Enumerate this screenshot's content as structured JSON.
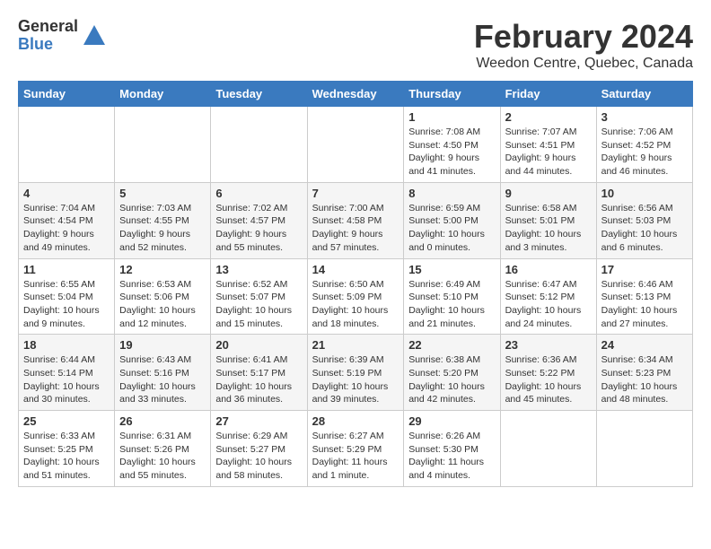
{
  "logo": {
    "general": "General",
    "blue": "Blue"
  },
  "title": {
    "month": "February 2024",
    "location": "Weedon Centre, Quebec, Canada"
  },
  "weekdays": [
    "Sunday",
    "Monday",
    "Tuesday",
    "Wednesday",
    "Thursday",
    "Friday",
    "Saturday"
  ],
  "weeks": [
    [
      {
        "day": "",
        "info": ""
      },
      {
        "day": "",
        "info": ""
      },
      {
        "day": "",
        "info": ""
      },
      {
        "day": "",
        "info": ""
      },
      {
        "day": "1",
        "info": "Sunrise: 7:08 AM\nSunset: 4:50 PM\nDaylight: 9 hours and 41 minutes."
      },
      {
        "day": "2",
        "info": "Sunrise: 7:07 AM\nSunset: 4:51 PM\nDaylight: 9 hours and 44 minutes."
      },
      {
        "day": "3",
        "info": "Sunrise: 7:06 AM\nSunset: 4:52 PM\nDaylight: 9 hours and 46 minutes."
      }
    ],
    [
      {
        "day": "4",
        "info": "Sunrise: 7:04 AM\nSunset: 4:54 PM\nDaylight: 9 hours and 49 minutes."
      },
      {
        "day": "5",
        "info": "Sunrise: 7:03 AM\nSunset: 4:55 PM\nDaylight: 9 hours and 52 minutes."
      },
      {
        "day": "6",
        "info": "Sunrise: 7:02 AM\nSunset: 4:57 PM\nDaylight: 9 hours and 55 minutes."
      },
      {
        "day": "7",
        "info": "Sunrise: 7:00 AM\nSunset: 4:58 PM\nDaylight: 9 hours and 57 minutes."
      },
      {
        "day": "8",
        "info": "Sunrise: 6:59 AM\nSunset: 5:00 PM\nDaylight: 10 hours and 0 minutes."
      },
      {
        "day": "9",
        "info": "Sunrise: 6:58 AM\nSunset: 5:01 PM\nDaylight: 10 hours and 3 minutes."
      },
      {
        "day": "10",
        "info": "Sunrise: 6:56 AM\nSunset: 5:03 PM\nDaylight: 10 hours and 6 minutes."
      }
    ],
    [
      {
        "day": "11",
        "info": "Sunrise: 6:55 AM\nSunset: 5:04 PM\nDaylight: 10 hours and 9 minutes."
      },
      {
        "day": "12",
        "info": "Sunrise: 6:53 AM\nSunset: 5:06 PM\nDaylight: 10 hours and 12 minutes."
      },
      {
        "day": "13",
        "info": "Sunrise: 6:52 AM\nSunset: 5:07 PM\nDaylight: 10 hours and 15 minutes."
      },
      {
        "day": "14",
        "info": "Sunrise: 6:50 AM\nSunset: 5:09 PM\nDaylight: 10 hours and 18 minutes."
      },
      {
        "day": "15",
        "info": "Sunrise: 6:49 AM\nSunset: 5:10 PM\nDaylight: 10 hours and 21 minutes."
      },
      {
        "day": "16",
        "info": "Sunrise: 6:47 AM\nSunset: 5:12 PM\nDaylight: 10 hours and 24 minutes."
      },
      {
        "day": "17",
        "info": "Sunrise: 6:46 AM\nSunset: 5:13 PM\nDaylight: 10 hours and 27 minutes."
      }
    ],
    [
      {
        "day": "18",
        "info": "Sunrise: 6:44 AM\nSunset: 5:14 PM\nDaylight: 10 hours and 30 minutes."
      },
      {
        "day": "19",
        "info": "Sunrise: 6:43 AM\nSunset: 5:16 PM\nDaylight: 10 hours and 33 minutes."
      },
      {
        "day": "20",
        "info": "Sunrise: 6:41 AM\nSunset: 5:17 PM\nDaylight: 10 hours and 36 minutes."
      },
      {
        "day": "21",
        "info": "Sunrise: 6:39 AM\nSunset: 5:19 PM\nDaylight: 10 hours and 39 minutes."
      },
      {
        "day": "22",
        "info": "Sunrise: 6:38 AM\nSunset: 5:20 PM\nDaylight: 10 hours and 42 minutes."
      },
      {
        "day": "23",
        "info": "Sunrise: 6:36 AM\nSunset: 5:22 PM\nDaylight: 10 hours and 45 minutes."
      },
      {
        "day": "24",
        "info": "Sunrise: 6:34 AM\nSunset: 5:23 PM\nDaylight: 10 hours and 48 minutes."
      }
    ],
    [
      {
        "day": "25",
        "info": "Sunrise: 6:33 AM\nSunset: 5:25 PM\nDaylight: 10 hours and 51 minutes."
      },
      {
        "day": "26",
        "info": "Sunrise: 6:31 AM\nSunset: 5:26 PM\nDaylight: 10 hours and 55 minutes."
      },
      {
        "day": "27",
        "info": "Sunrise: 6:29 AM\nSunset: 5:27 PM\nDaylight: 10 hours and 58 minutes."
      },
      {
        "day": "28",
        "info": "Sunrise: 6:27 AM\nSunset: 5:29 PM\nDaylight: 11 hours and 1 minute."
      },
      {
        "day": "29",
        "info": "Sunrise: 6:26 AM\nSunset: 5:30 PM\nDaylight: 11 hours and 4 minutes."
      },
      {
        "day": "",
        "info": ""
      },
      {
        "day": "",
        "info": ""
      }
    ]
  ]
}
